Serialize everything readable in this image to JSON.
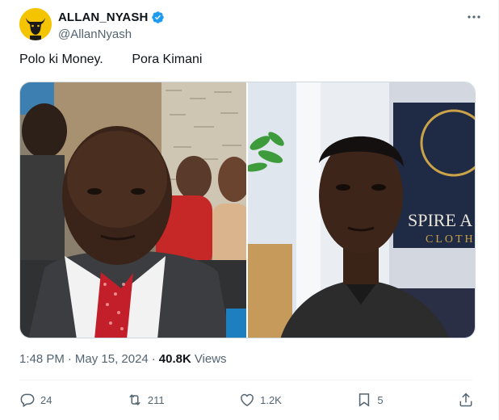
{
  "author": {
    "display_name": "ALLAN_NYASH",
    "handle": "@AllanNyash",
    "verified": true
  },
  "tweet": {
    "text": "Polo ki Money.        Pora Kimani",
    "images": [
      {
        "description": "man in suit with red tie"
      },
      {
        "description": "young man in front of store sign",
        "sign_text_1": "SPIRE A",
        "sign_text_2": "CLOTH"
      }
    ]
  },
  "meta": {
    "time": "1:48 PM",
    "separator_1": "·",
    "date": "May 15, 2024",
    "separator_2": "·",
    "views_count": "40.8K",
    "views_label": "Views"
  },
  "actions": {
    "reply_count": "24",
    "retweet_count": "211",
    "like_count": "1.2K",
    "bookmark_count": "5"
  },
  "colors": {
    "text_primary": "#0f1419",
    "text_secondary": "#536471",
    "verified_blue": "#1d9bf0",
    "divider": "#eff3f4"
  }
}
